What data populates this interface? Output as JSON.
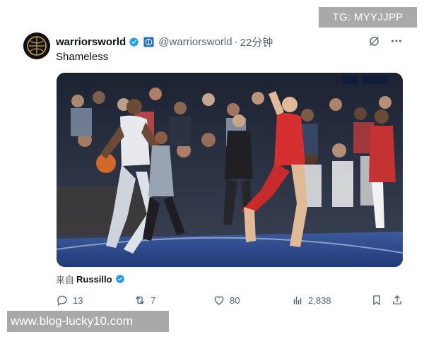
{
  "watermark_top": "TG: MYYJJPP",
  "watermark_bottom": "www.blog-lucky10.com",
  "tweet": {
    "display_name": "warriorsworld",
    "handle": "@warriorsworld",
    "separator": "·",
    "time": "22分钟",
    "text": "Shameless",
    "media_alt": "basketball-game-video-frame",
    "source_prefix": "来自",
    "source_name": "Russillo",
    "verified_color": "#1d9bf0",
    "affiliate_color": "#1d6fd1"
  },
  "actions": {
    "reply_count": "13",
    "repost_count": "7",
    "like_count": "80",
    "view_count": "2,838"
  },
  "icons": [
    "grok-icon",
    "more-icon",
    "reply-icon",
    "repost-icon",
    "like-icon",
    "views-icon",
    "bookmark-icon",
    "share-icon",
    "verified-badge-icon",
    "affiliate-badge-icon"
  ]
}
